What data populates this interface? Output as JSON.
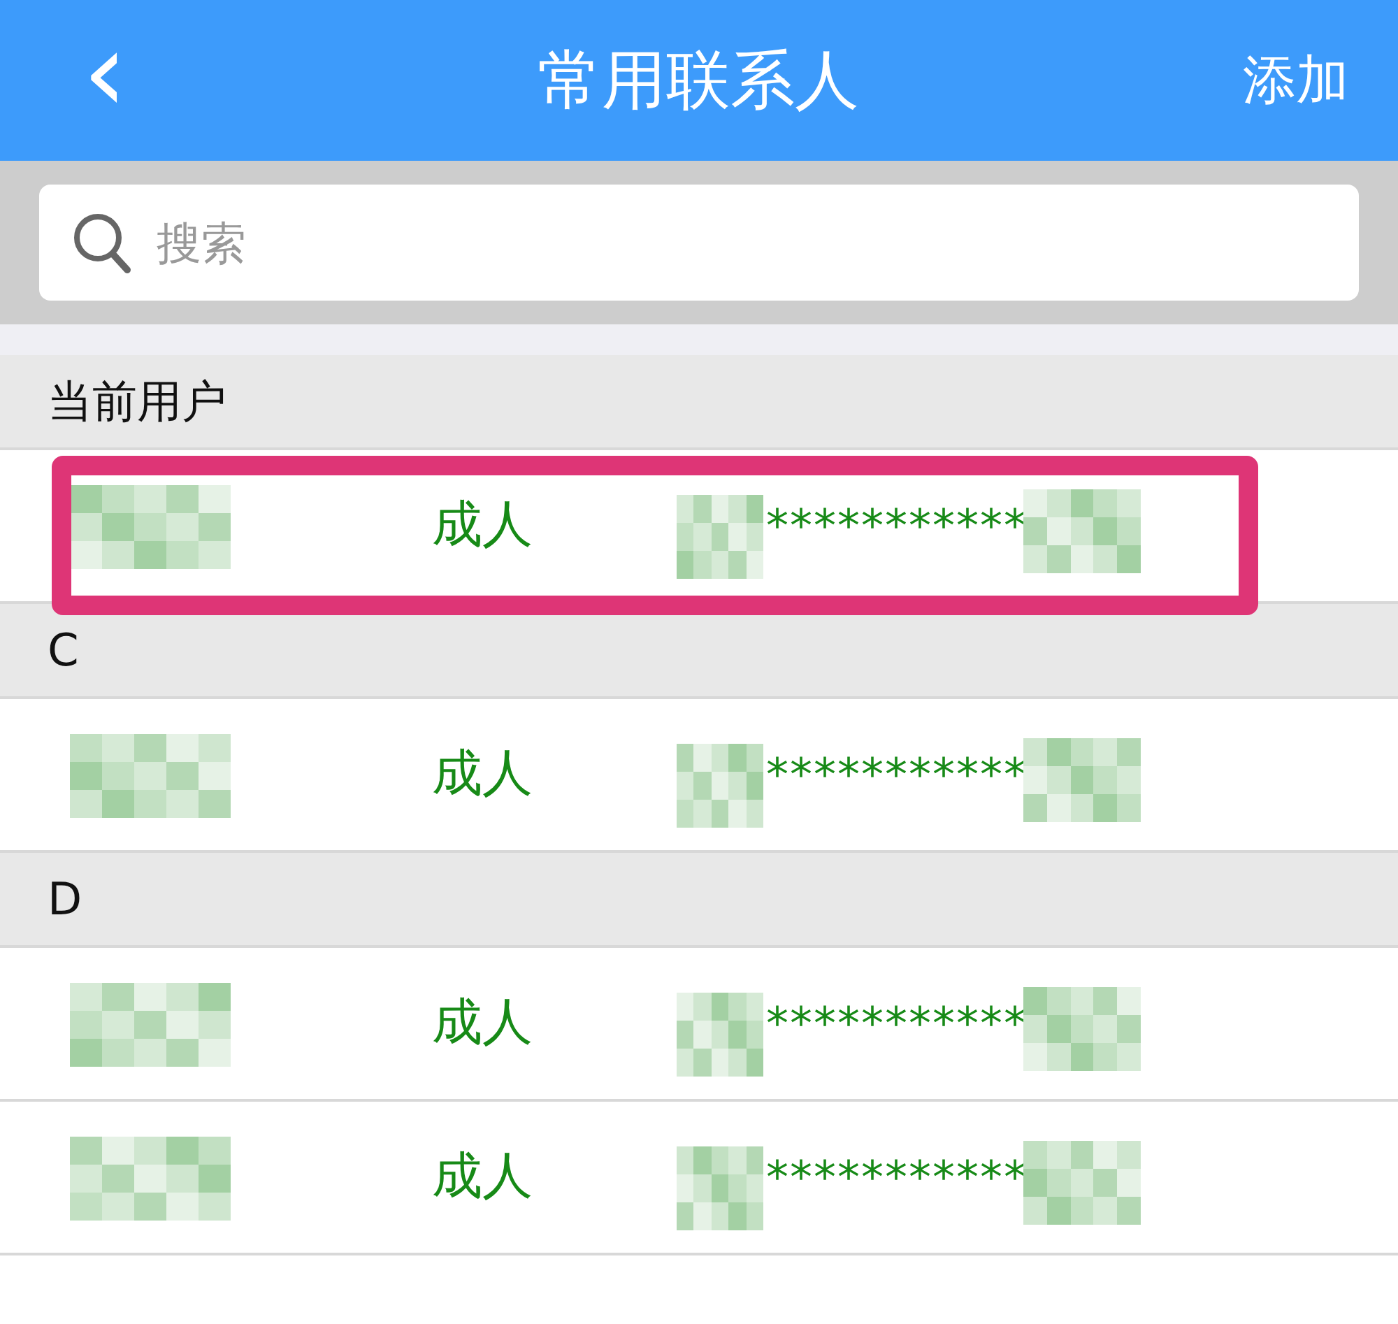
{
  "header": {
    "back": "‹",
    "title": "常用联系人",
    "action": "添加"
  },
  "search": {
    "placeholder": "搜索"
  },
  "sections": [
    {
      "title": "当前用户",
      "contacts": [
        {
          "type": "成人",
          "id_number": "***********",
          "highlighted": true
        }
      ]
    },
    {
      "title": "C",
      "contacts": [
        {
          "type": "成人",
          "id_number": "***********",
          "highlighted": false
        }
      ]
    },
    {
      "title": "D",
      "contacts": [
        {
          "type": "成人",
          "id_number": "***********",
          "highlighted": false
        },
        {
          "type": "成人",
          "id_number": "***********",
          "highlighted": false
        }
      ]
    }
  ]
}
